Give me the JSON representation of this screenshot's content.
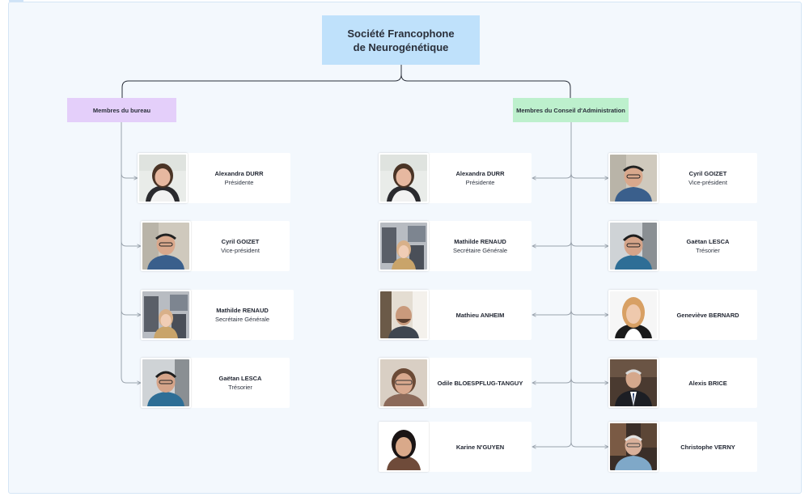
{
  "title": {
    "line1": "Société Francophone",
    "line2": "de Neurogénétique"
  },
  "groups": {
    "bureau": "Membres du bureau",
    "conseil": "Membres du Conseil d'Administration"
  },
  "bureau_members": [
    {
      "name": "Alexandra DURR",
      "role": "Présidente"
    },
    {
      "name": "Cyril GOIZET",
      "role": "Vice-président"
    },
    {
      "name": "Mathilde RENAUD",
      "role": "Secrétaire Générale"
    },
    {
      "name": "Gaëtan LESCA",
      "role": "Trésorier"
    }
  ],
  "conseil_left": [
    {
      "name": "Alexandra DURR",
      "role": "Présidente"
    },
    {
      "name": "Mathilde RENAUD",
      "role": "Secrétaire Générale"
    },
    {
      "name": "Mathieu ANHEIM",
      "role": ""
    },
    {
      "name": "Odile BLOESPFLUG-TANGUY",
      "role": ""
    },
    {
      "name": "Karine N'GUYEN",
      "role": ""
    }
  ],
  "conseil_right": [
    {
      "name": "Cyril GOIZET",
      "role": "Vice-président"
    },
    {
      "name": "Gaëtan LESCA",
      "role": "Trésorier"
    },
    {
      "name": "Geneviève BERNARD",
      "role": ""
    },
    {
      "name": "Alexis BRICE",
      "role": ""
    },
    {
      "name": "Christophe VERNY",
      "role": ""
    }
  ],
  "colors": {
    "title_bg": "#bfe1fb",
    "bureau_bg": "#e4cffa",
    "conseil_bg": "#bdf0cd",
    "board_bg": "#f3f8fd",
    "line": "#9aa3ad"
  }
}
